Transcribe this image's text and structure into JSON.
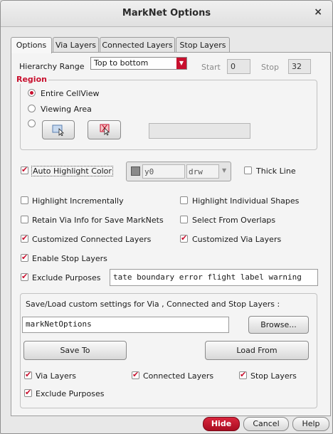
{
  "window": {
    "title": "MarkNet Options",
    "close_label": "×"
  },
  "tabs": [
    {
      "label": "Options",
      "active": true
    },
    {
      "label": "Via Layers",
      "active": false
    },
    {
      "label": "Connected Layers",
      "active": false
    },
    {
      "label": "Stop Layers",
      "active": false
    }
  ],
  "hierarchy": {
    "label": "Hierarchy Range",
    "selected": "Top to bottom",
    "start_label": "Start",
    "start_value": "0",
    "stop_label": "Stop",
    "stop_value": "32"
  },
  "region": {
    "title": "Region",
    "options": [
      {
        "label": "Entire CellView",
        "selected": true
      },
      {
        "label": "Viewing Area",
        "selected": false
      }
    ],
    "third_option_selected": false,
    "coords_value": ""
  },
  "highlight": {
    "auto_color_label": "Auto Highlight Color",
    "auto_color_checked": true,
    "color_name": "y0",
    "purpose": "drw",
    "swatch_color": "#8a8a8a",
    "thick_line_label": "Thick Line",
    "thick_line_checked": false
  },
  "options_left": [
    {
      "label": "Highlight Incrementally",
      "checked": false
    },
    {
      "label": "Retain Via Info for Save MarkNets",
      "checked": false
    },
    {
      "label": "Customized Connected Layers",
      "checked": true
    },
    {
      "label": "Enable Stop Layers",
      "checked": true
    }
  ],
  "options_right": [
    {
      "label": "Highlight Individual Shapes",
      "checked": false
    },
    {
      "label": "Select From Overlaps",
      "checked": false
    },
    {
      "label": "Customized Via Layers",
      "checked": true
    }
  ],
  "exclude_purposes": {
    "label": "Exclude Purposes",
    "checked": true,
    "value": "tate boundary error flight label warning"
  },
  "save_load": {
    "title": "Save/Load custom settings for Via , Connected and Stop Layers :",
    "filename": "markNetOptions",
    "browse_label": "Browse...",
    "save_label": "Save To",
    "load_label": "Load From",
    "checks": [
      {
        "label": "Via Layers",
        "checked": true
      },
      {
        "label": "Connected Layers",
        "checked": true
      },
      {
        "label": "Stop Layers",
        "checked": true
      },
      {
        "label": "Exclude Purposes",
        "checked": true
      }
    ]
  },
  "footer": {
    "hide_label": "Hide",
    "cancel_label": "Cancel",
    "help_label": "Help"
  },
  "colors": {
    "accent": "#c8102e",
    "background": "#e8e8e8"
  }
}
